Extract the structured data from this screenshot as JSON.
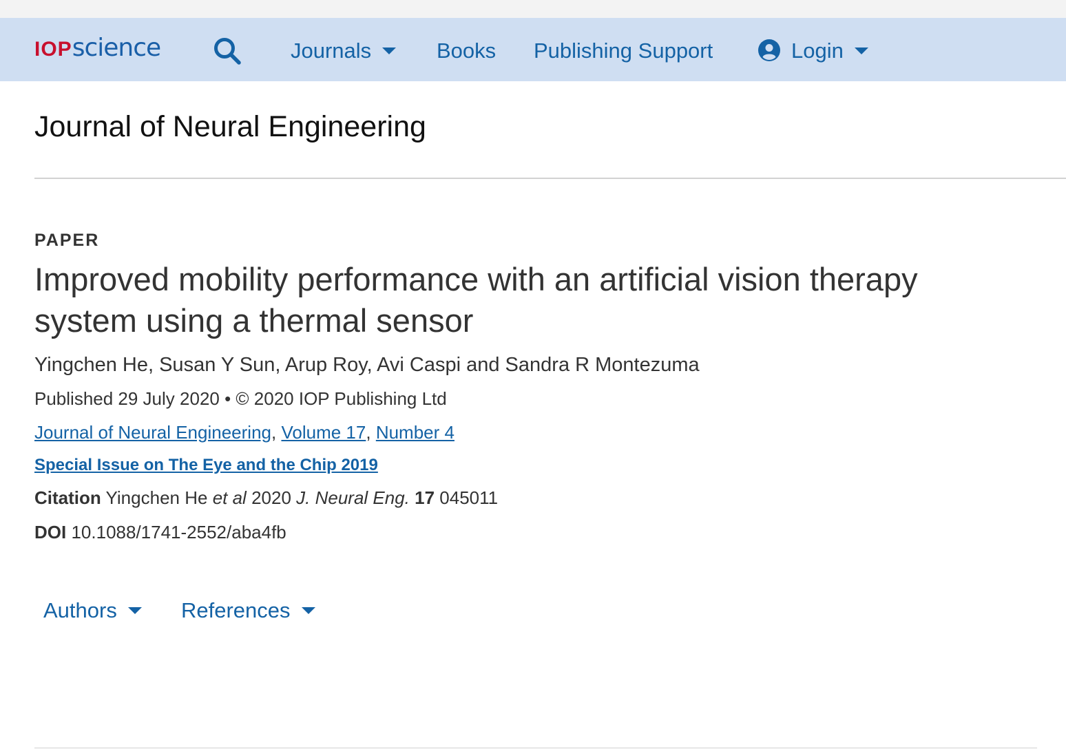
{
  "header": {
    "logo_part1": "IOP",
    "logo_part2": "science",
    "search_icon": "search-icon",
    "nav": {
      "journals": "Journals",
      "books": "Books",
      "publishing_support": "Publishing Support",
      "login": "Login"
    }
  },
  "journal": {
    "title": "Journal of Neural Engineering"
  },
  "article": {
    "type": "PAPER",
    "title": "Improved mobility performance with an artificial vision therapy system using a thermal sensor",
    "authors": "Yingchen He, Susan Y Sun, Arup Roy, Avi Caspi and Sandra R Montezuma",
    "published": "Published 29 July 2020 • © 2020 IOP Publishing Ltd",
    "links": {
      "journal": "Journal of Neural Engineering",
      "volume": "Volume 17",
      "number": "Number 4",
      "sep": ","
    },
    "special_issue": "Special Issue on The Eye and the Chip 2019",
    "citation": {
      "label": "Citation",
      "author": "Yingchen He",
      "etal": "et al",
      "year": "2020",
      "journal_abbr": "J. Neural Eng.",
      "volume": "17",
      "article_no": "045011"
    },
    "doi": {
      "label": "DOI",
      "value": "10.1088/1741-2552/aba4fb"
    }
  },
  "toggles": {
    "authors": "Authors",
    "references": "References"
  },
  "colors": {
    "navbar_bg": "#cfdef2",
    "link": "#1462a5",
    "logo_red": "#c8102e",
    "logo_blue": "#1a5fa8"
  }
}
